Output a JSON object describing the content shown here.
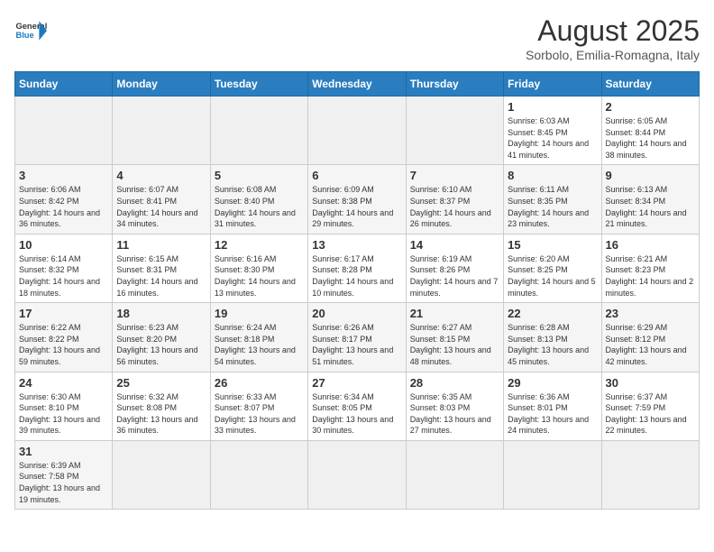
{
  "header": {
    "logo_general": "General",
    "logo_blue": "Blue",
    "title": "August 2025",
    "subtitle": "Sorbolo, Emilia-Romagna, Italy"
  },
  "weekdays": [
    "Sunday",
    "Monday",
    "Tuesday",
    "Wednesday",
    "Thursday",
    "Friday",
    "Saturday"
  ],
  "weeks": [
    [
      {
        "day": "",
        "info": ""
      },
      {
        "day": "",
        "info": ""
      },
      {
        "day": "",
        "info": ""
      },
      {
        "day": "",
        "info": ""
      },
      {
        "day": "",
        "info": ""
      },
      {
        "day": "1",
        "info": "Sunrise: 6:03 AM\nSunset: 8:45 PM\nDaylight: 14 hours and 41 minutes."
      },
      {
        "day": "2",
        "info": "Sunrise: 6:05 AM\nSunset: 8:44 PM\nDaylight: 14 hours and 38 minutes."
      }
    ],
    [
      {
        "day": "3",
        "info": "Sunrise: 6:06 AM\nSunset: 8:42 PM\nDaylight: 14 hours and 36 minutes."
      },
      {
        "day": "4",
        "info": "Sunrise: 6:07 AM\nSunset: 8:41 PM\nDaylight: 14 hours and 34 minutes."
      },
      {
        "day": "5",
        "info": "Sunrise: 6:08 AM\nSunset: 8:40 PM\nDaylight: 14 hours and 31 minutes."
      },
      {
        "day": "6",
        "info": "Sunrise: 6:09 AM\nSunset: 8:38 PM\nDaylight: 14 hours and 29 minutes."
      },
      {
        "day": "7",
        "info": "Sunrise: 6:10 AM\nSunset: 8:37 PM\nDaylight: 14 hours and 26 minutes."
      },
      {
        "day": "8",
        "info": "Sunrise: 6:11 AM\nSunset: 8:35 PM\nDaylight: 14 hours and 23 minutes."
      },
      {
        "day": "9",
        "info": "Sunrise: 6:13 AM\nSunset: 8:34 PM\nDaylight: 14 hours and 21 minutes."
      }
    ],
    [
      {
        "day": "10",
        "info": "Sunrise: 6:14 AM\nSunset: 8:32 PM\nDaylight: 14 hours and 18 minutes."
      },
      {
        "day": "11",
        "info": "Sunrise: 6:15 AM\nSunset: 8:31 PM\nDaylight: 14 hours and 16 minutes."
      },
      {
        "day": "12",
        "info": "Sunrise: 6:16 AM\nSunset: 8:30 PM\nDaylight: 14 hours and 13 minutes."
      },
      {
        "day": "13",
        "info": "Sunrise: 6:17 AM\nSunset: 8:28 PM\nDaylight: 14 hours and 10 minutes."
      },
      {
        "day": "14",
        "info": "Sunrise: 6:19 AM\nSunset: 8:26 PM\nDaylight: 14 hours and 7 minutes."
      },
      {
        "day": "15",
        "info": "Sunrise: 6:20 AM\nSunset: 8:25 PM\nDaylight: 14 hours and 5 minutes."
      },
      {
        "day": "16",
        "info": "Sunrise: 6:21 AM\nSunset: 8:23 PM\nDaylight: 14 hours and 2 minutes."
      }
    ],
    [
      {
        "day": "17",
        "info": "Sunrise: 6:22 AM\nSunset: 8:22 PM\nDaylight: 13 hours and 59 minutes."
      },
      {
        "day": "18",
        "info": "Sunrise: 6:23 AM\nSunset: 8:20 PM\nDaylight: 13 hours and 56 minutes."
      },
      {
        "day": "19",
        "info": "Sunrise: 6:24 AM\nSunset: 8:18 PM\nDaylight: 13 hours and 54 minutes."
      },
      {
        "day": "20",
        "info": "Sunrise: 6:26 AM\nSunset: 8:17 PM\nDaylight: 13 hours and 51 minutes."
      },
      {
        "day": "21",
        "info": "Sunrise: 6:27 AM\nSunset: 8:15 PM\nDaylight: 13 hours and 48 minutes."
      },
      {
        "day": "22",
        "info": "Sunrise: 6:28 AM\nSunset: 8:13 PM\nDaylight: 13 hours and 45 minutes."
      },
      {
        "day": "23",
        "info": "Sunrise: 6:29 AM\nSunset: 8:12 PM\nDaylight: 13 hours and 42 minutes."
      }
    ],
    [
      {
        "day": "24",
        "info": "Sunrise: 6:30 AM\nSunset: 8:10 PM\nDaylight: 13 hours and 39 minutes."
      },
      {
        "day": "25",
        "info": "Sunrise: 6:32 AM\nSunset: 8:08 PM\nDaylight: 13 hours and 36 minutes."
      },
      {
        "day": "26",
        "info": "Sunrise: 6:33 AM\nSunset: 8:07 PM\nDaylight: 13 hours and 33 minutes."
      },
      {
        "day": "27",
        "info": "Sunrise: 6:34 AM\nSunset: 8:05 PM\nDaylight: 13 hours and 30 minutes."
      },
      {
        "day": "28",
        "info": "Sunrise: 6:35 AM\nSunset: 8:03 PM\nDaylight: 13 hours and 27 minutes."
      },
      {
        "day": "29",
        "info": "Sunrise: 6:36 AM\nSunset: 8:01 PM\nDaylight: 13 hours and 24 minutes."
      },
      {
        "day": "30",
        "info": "Sunrise: 6:37 AM\nSunset: 7:59 PM\nDaylight: 13 hours and 22 minutes."
      }
    ],
    [
      {
        "day": "31",
        "info": "Sunrise: 6:39 AM\nSunset: 7:58 PM\nDaylight: 13 hours and 19 minutes."
      },
      {
        "day": "",
        "info": ""
      },
      {
        "day": "",
        "info": ""
      },
      {
        "day": "",
        "info": ""
      },
      {
        "day": "",
        "info": ""
      },
      {
        "day": "",
        "info": ""
      },
      {
        "day": "",
        "info": ""
      }
    ]
  ]
}
